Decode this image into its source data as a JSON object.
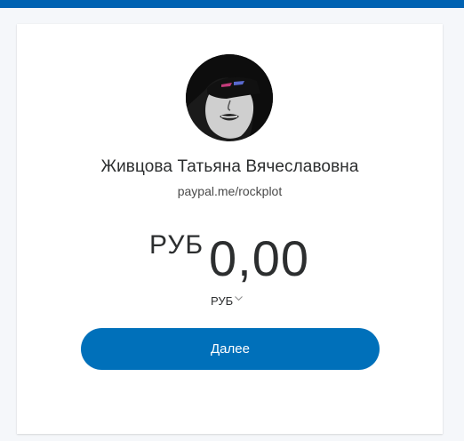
{
  "profile": {
    "name": "Живцова Татьяна Вячеславовна",
    "link": "paypal.me/rockplot",
    "avatar_icon": "profile-photo"
  },
  "payment": {
    "currency_symbol": "РУБ",
    "amount": "0,00",
    "currency_code": "РУБ",
    "currency_selector_icon": "chevron-down-icon"
  },
  "actions": {
    "next_label": "Далее"
  },
  "colors": {
    "brand_bar": "#0062b2",
    "button": "#0070ba",
    "background": "#f5f7fa",
    "text": "#2c2e2f"
  }
}
